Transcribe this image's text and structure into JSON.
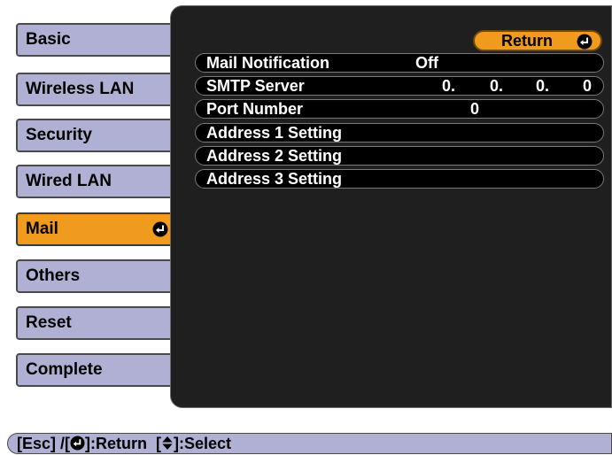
{
  "menu": {
    "items": [
      {
        "label": "Basic",
        "active": false
      },
      {
        "label": "Wireless LAN",
        "active": false
      },
      {
        "label": "Security",
        "active": false
      },
      {
        "label": "Wired LAN",
        "active": false
      },
      {
        "label": "Mail",
        "active": true
      },
      {
        "label": "Others",
        "active": false
      },
      {
        "label": "Reset",
        "active": false
      },
      {
        "label": "Complete",
        "active": false
      }
    ]
  },
  "panel": {
    "return_label": "Return",
    "rows": [
      {
        "label": "Mail Notification",
        "value": "Off"
      },
      {
        "label": "SMTP Server",
        "ip": [
          "0.",
          "0.",
          "0.",
          "0"
        ]
      },
      {
        "label": "Port Number",
        "value": "0"
      },
      {
        "label": "Address 1 Setting"
      },
      {
        "label": "Address 2 Setting"
      },
      {
        "label": "Address 3 Setting"
      }
    ]
  },
  "help": {
    "esc": "[Esc] /[",
    "return_text": "]:Return",
    "select_open": "[",
    "select_text": "]:Select"
  },
  "icons": {
    "enter": "enter-icon",
    "updown": "up-down-arrow-icon"
  },
  "colors": {
    "menu_bg": "#b0b0d4",
    "menu_active": "#f09a1e",
    "panel_bg": "#1f1f1f",
    "row_bg": "#000000"
  }
}
